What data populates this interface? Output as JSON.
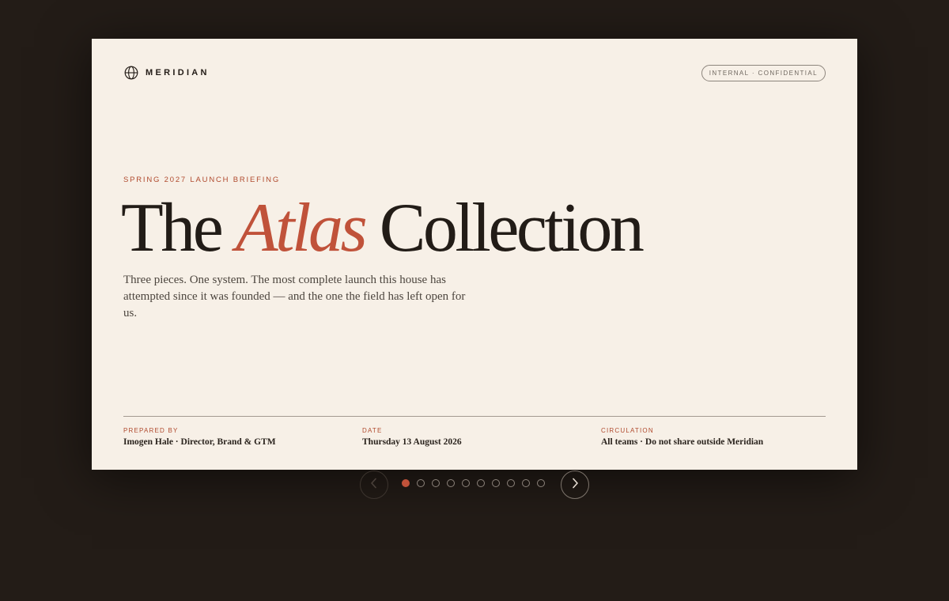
{
  "brand": {
    "name": "MERIDIAN",
    "icon": "globe-icon"
  },
  "badge": "INTERNAL · CONFIDENTIAL",
  "slide": {
    "kicker": "SPRING 2027 LAUNCH BRIEFING",
    "title_before": "The",
    "title_accent": "Atlas",
    "title_after": "Collection",
    "lede": "Three pieces. One system. The most complete launch this house has attempted since it was founded — and the one the field has left open for us."
  },
  "meta": {
    "prepared_by": {
      "label": "PREPARED BY",
      "value": "Imogen Hale · Director, Brand & GTM"
    },
    "date": {
      "label": "DATE",
      "value": "Thursday 13 August 2026"
    },
    "circulation": {
      "label": "CIRCULATION",
      "value": "All teams · Do not share outside Meridian"
    }
  },
  "pagination": {
    "total_slides": 10,
    "current_slide": 1,
    "prev_icon": "chevron-left-icon",
    "next_icon": "chevron-right-icon"
  },
  "colors": {
    "background": "#231c17",
    "slide": "#f7f0e7",
    "accent": "#c0523a",
    "ink": "#221c17"
  }
}
